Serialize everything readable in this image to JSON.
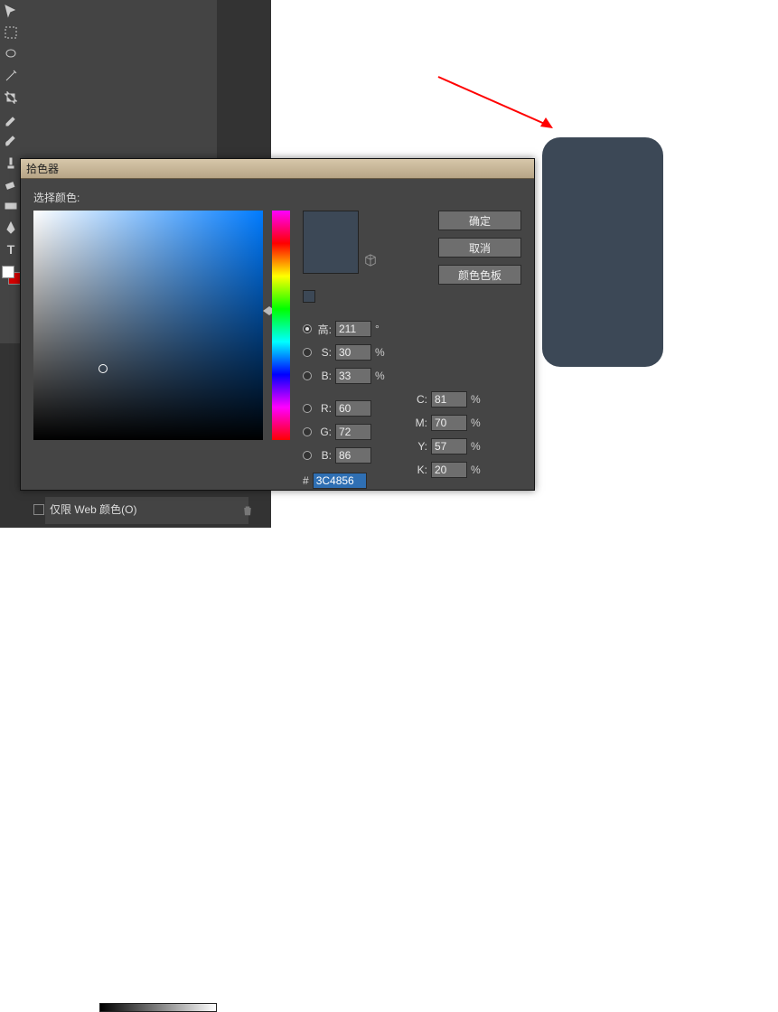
{
  "dialog": {
    "title": "拾色器",
    "select_label": "选择颜色:",
    "ok": "确定",
    "cancel": "取消",
    "swatches": "颜色色板",
    "hex_prefix": "#",
    "hex_value": "3C4856",
    "web_only_label": "仅限 Web 颜色(O)",
    "preview_color": "#3C4856"
  },
  "hsb": {
    "h_label": "高:",
    "h_value": "211",
    "h_unit": "°",
    "s_label": "S:",
    "s_value": "30",
    "s_unit": "%",
    "b_label": "B:",
    "b_value": "33",
    "b_unit": "%"
  },
  "rgb": {
    "r_label": "R:",
    "r_value": "60",
    "g_label": "G:",
    "g_value": "72",
    "b_label": "B:",
    "b_value": "86"
  },
  "cmyk": {
    "c_label": "C:",
    "c_value": "81",
    "unit": "%",
    "m_label": "M:",
    "m_value": "70",
    "y_label": "Y:",
    "y_value": "57",
    "k_label": "K:",
    "k_value": "20"
  }
}
